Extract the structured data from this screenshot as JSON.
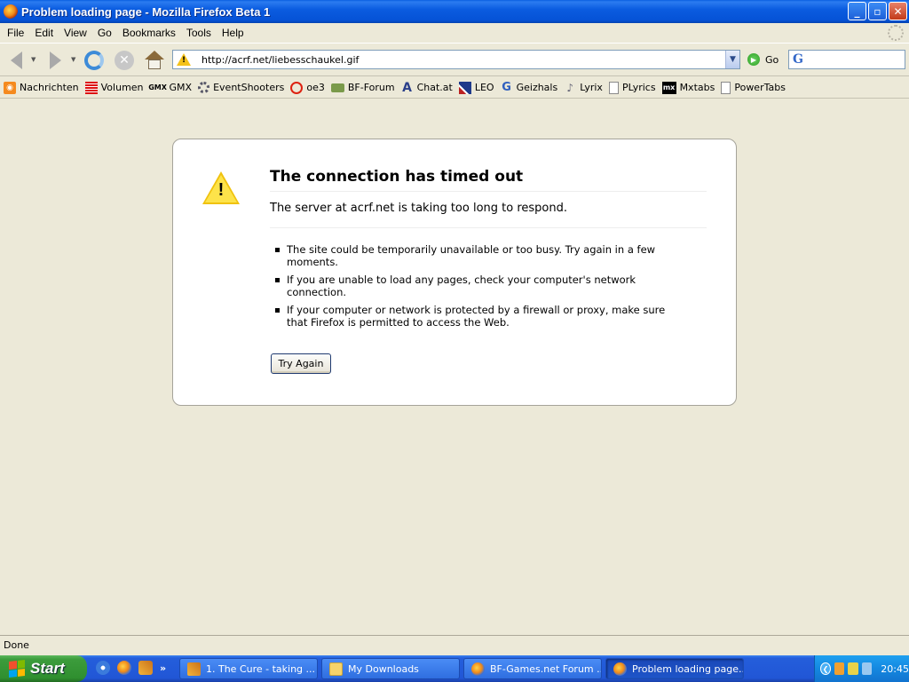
{
  "window": {
    "title": "Problem loading page - Mozilla Firefox Beta 1",
    "minimize": "_",
    "maximize": "▫",
    "close": "✕"
  },
  "menu": {
    "items": [
      {
        "label": "File"
      },
      {
        "label": "Edit"
      },
      {
        "label": "View"
      },
      {
        "label": "Go"
      },
      {
        "label": "Bookmarks"
      },
      {
        "label": "Tools"
      },
      {
        "label": "Help"
      }
    ]
  },
  "navbar": {
    "url": "http://acrf.net/liebesschaukel.gif",
    "go_label": "Go"
  },
  "bookmarks": [
    {
      "label": "Nachrichten",
      "icon": "rss-icon"
    },
    {
      "label": "Volumen",
      "icon": "volumen-icon"
    },
    {
      "label": "GMX",
      "icon": "gmx-icon"
    },
    {
      "label": "EventShooters",
      "icon": "gear-icon"
    },
    {
      "label": "oe3",
      "icon": "target-icon"
    },
    {
      "label": "BF-Forum",
      "icon": "money-icon"
    },
    {
      "label": "Chat.at",
      "icon": "chat-icon"
    },
    {
      "label": "LEO",
      "icon": "flag-icon"
    },
    {
      "label": "Geizhals",
      "icon": "geizhals-icon"
    },
    {
      "label": "Lyrix",
      "icon": "lyrix-icon"
    },
    {
      "label": "PLyrics",
      "icon": "page-icon"
    },
    {
      "label": "Mxtabs",
      "icon": "mx-icon"
    },
    {
      "label": "PowerTabs",
      "icon": "page-icon"
    }
  ],
  "error": {
    "title": "The connection has timed out",
    "description": "The server at acrf.net is taking too long to respond.",
    "bullets": [
      "The site could be temporarily unavailable or too busy. Try again in a few moments.",
      "If you are unable to load any pages, check your computer's network connection.",
      "If your computer or network is protected by a firewall or proxy, make sure that Firefox is permitted to access the Web."
    ],
    "button": "Try Again"
  },
  "status": {
    "text": "Done"
  },
  "taskbar": {
    "start_label": "Start",
    "quick_more": "»",
    "tasks": [
      {
        "label": "1. The Cure - taking ...",
        "icon": "winamp-icon"
      },
      {
        "label": "My Downloads",
        "icon": "folder-icon"
      },
      {
        "label": "BF-Games.net Forum ...",
        "icon": "firefox-icon"
      },
      {
        "label": "Problem loading page...",
        "icon": "firefox-icon"
      }
    ],
    "clock": "20:45"
  }
}
